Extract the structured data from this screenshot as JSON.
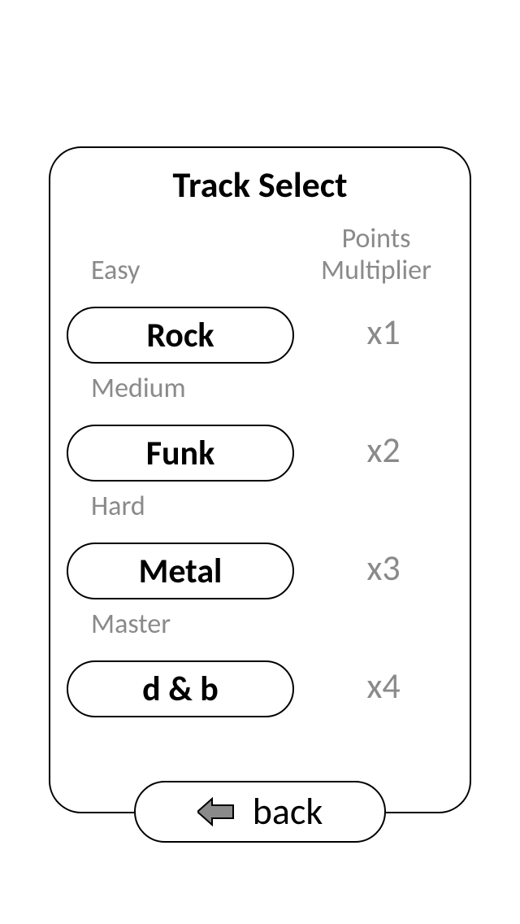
{
  "title": "Track Select",
  "multiplier_header_line1": "Points",
  "multiplier_header_line2": "Multiplier",
  "tracks": [
    {
      "difficulty": "Easy",
      "name": "Rock",
      "multiplier": "x1"
    },
    {
      "difficulty": "Medium",
      "name": "Funk",
      "multiplier": "x2"
    },
    {
      "difficulty": "Hard",
      "name": "Metal",
      "multiplier": "x3"
    },
    {
      "difficulty": "Master",
      "name": "d & b",
      "multiplier": "x4"
    }
  ],
  "back_label": "back"
}
